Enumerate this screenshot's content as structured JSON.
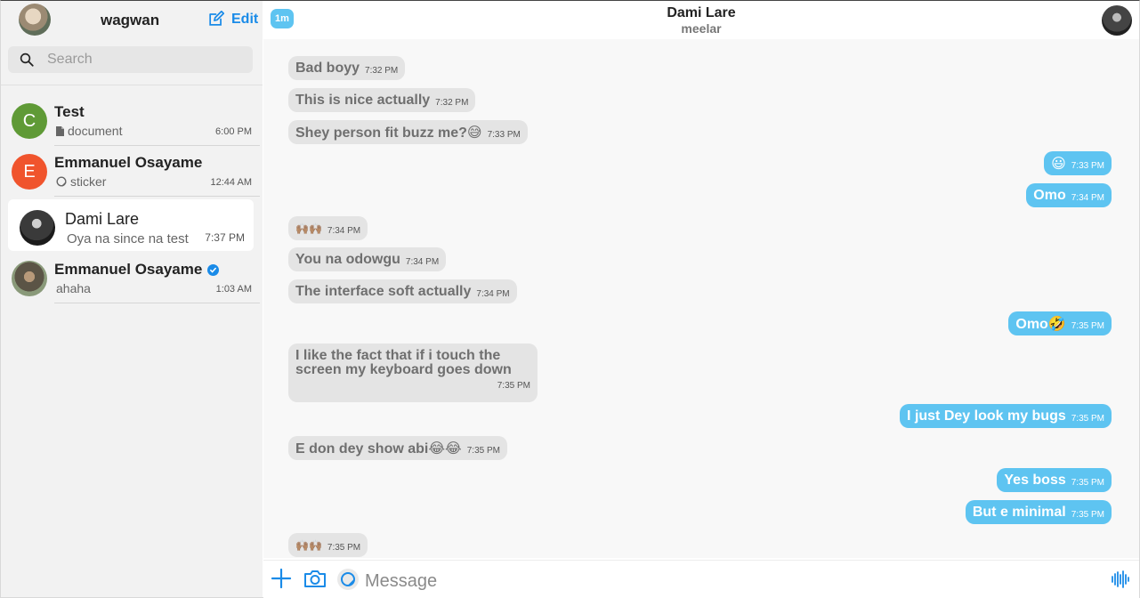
{
  "sidebar": {
    "username": "wagwan",
    "edit_label": "Edit",
    "search_placeholder": "Search",
    "chats": [
      {
        "initial": "C",
        "avatar_color": "#5f9a36",
        "name": "Test",
        "preview": "document",
        "preview_icon": "document-icon",
        "time": "6:00 PM"
      },
      {
        "initial": "E",
        "avatar_color": "#f0542d",
        "name": "Emmanuel Osayame",
        "preview": "sticker",
        "preview_icon": "sticker-icon",
        "time": "12:44 AM"
      },
      {
        "name": "Dami Lare",
        "preview": "Oya na since na test",
        "time": "7:37 PM",
        "active": true
      },
      {
        "name": "Emmanuel Osayame",
        "preview": "ahaha",
        "time": "1:03 AM",
        "verified": true
      }
    ]
  },
  "header": {
    "last_seen_badge": "1m",
    "title": "Dami Lare",
    "subtitle": "meelar"
  },
  "messages": [
    {
      "dir": "in",
      "text": "Bad boyy",
      "time": "7:32 PM"
    },
    {
      "dir": "in",
      "text": "This is nice actually",
      "time": "7:32 PM"
    },
    {
      "dir": "in",
      "text": "Shey person fit buzz me?😅",
      "time": "7:33 PM"
    },
    {
      "dir": "out",
      "text": "😃",
      "time": "7:33 PM"
    },
    {
      "dir": "out",
      "text": "Omo",
      "time": "7:34 PM"
    },
    {
      "dir": "in",
      "text": "🙌🏽🙌🏽",
      "time": "7:34 PM"
    },
    {
      "dir": "in",
      "text": "You na odowgu",
      "time": "7:34 PM"
    },
    {
      "dir": "in",
      "text": "The interface soft actually",
      "time": "7:34 PM"
    },
    {
      "dir": "out",
      "text": "Omo🤣",
      "time": "7:35 PM"
    },
    {
      "dir": "in",
      "text": "I like the fact that if i touch the screen my keyboard goes down",
      "time": "7:35 PM"
    },
    {
      "dir": "out",
      "text": "I just Dey look my bugs",
      "time": "7:35 PM"
    },
    {
      "dir": "in",
      "text": "E don dey show abi😂😂",
      "time": "7:35 PM"
    },
    {
      "dir": "out",
      "text": "Yes boss",
      "time": "7:35 PM"
    },
    {
      "dir": "out",
      "text": "But e minimal",
      "time": "7:35 PM"
    },
    {
      "dir": "in",
      "text": "🙌🏽🙌🏽",
      "time": "7:35 PM"
    }
  ],
  "composer": {
    "placeholder": "Message"
  },
  "colors": {
    "accent": "#1a8be8",
    "outgoing_bubble": "#5ec4f1",
    "incoming_bubble": "#e4e4e4"
  }
}
